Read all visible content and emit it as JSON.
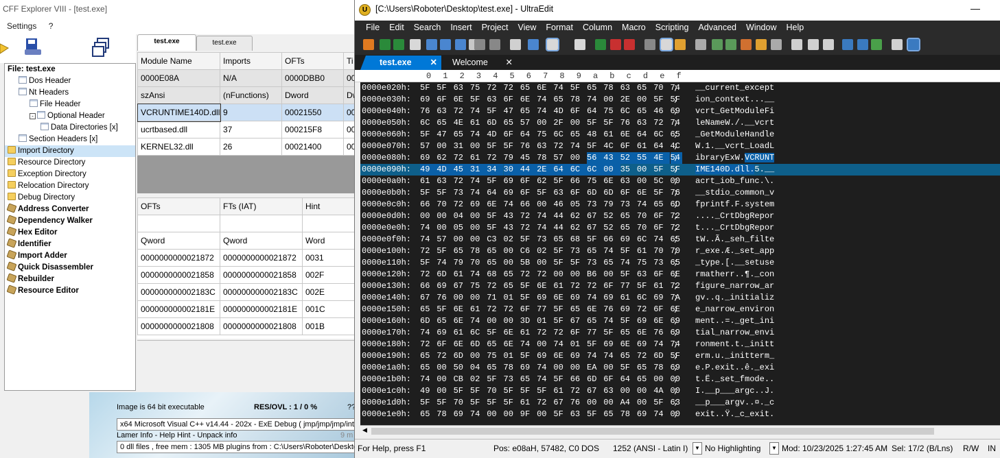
{
  "cff": {
    "title": "CFF Explorer VIII - [test.exe]",
    "menu": [
      "Settings",
      "?"
    ],
    "tabs": [
      "test.exe",
      "test.exe"
    ],
    "tree": [
      {
        "label": "File: test.exe",
        "level": 0,
        "icon": "none",
        "bold": true
      },
      {
        "label": "Dos Header",
        "level": 1,
        "icon": "doc"
      },
      {
        "label": "Nt Headers",
        "level": 1,
        "icon": "doc"
      },
      {
        "label": "File Header",
        "level": 2,
        "icon": "doc"
      },
      {
        "label": "Optional Header",
        "level": 2,
        "icon": "doc",
        "expander": "-"
      },
      {
        "label": "Data Directories [x]",
        "level": 3,
        "icon": "doc"
      },
      {
        "label": "Section Headers [x]",
        "level": 1,
        "icon": "doc"
      },
      {
        "label": "Import Directory",
        "level": 0,
        "icon": "folder",
        "selected": true
      },
      {
        "label": "Resource Directory",
        "level": 0,
        "icon": "folder"
      },
      {
        "label": "Exception Directory",
        "level": 0,
        "icon": "folder"
      },
      {
        "label": "Relocation Directory",
        "level": 0,
        "icon": "folder"
      },
      {
        "label": "Debug Directory",
        "level": 0,
        "icon": "folder"
      },
      {
        "label": "Address Converter",
        "level": 0,
        "icon": "tool",
        "bold": true
      },
      {
        "label": "Dependency Walker",
        "level": 0,
        "icon": "tool",
        "bold": true
      },
      {
        "label": "Hex Editor",
        "level": 0,
        "icon": "tool",
        "bold": true
      },
      {
        "label": "Identifier",
        "level": 0,
        "icon": "tool",
        "bold": true
      },
      {
        "label": "Import Adder",
        "level": 0,
        "icon": "tool",
        "bold": true
      },
      {
        "label": "Quick Disassembler",
        "level": 0,
        "icon": "tool",
        "bold": true
      },
      {
        "label": "Rebuilder",
        "level": 0,
        "icon": "tool",
        "bold": true
      },
      {
        "label": "Resource Editor",
        "level": 0,
        "icon": "tool",
        "bold": true
      }
    ],
    "modules_table": {
      "headers": [
        "Module Name",
        "Imports",
        "OFTs",
        "Ti"
      ],
      "subheaders": [
        "0000E08A",
        "N/A",
        "0000DBB0",
        "00"
      ],
      "types": [
        "szAnsi",
        "(nFunctions)",
        "Dword",
        "Dw"
      ],
      "rows": [
        [
          "VCRUNTIME140D.dll",
          "9",
          "00021550",
          "00"
        ],
        [
          "ucrtbased.dll",
          "37",
          "000215F8",
          "00"
        ],
        [
          "KERNEL32.dll",
          "26",
          "00021400",
          "00"
        ]
      ]
    },
    "functions_table": {
      "headers": [
        "OFTs",
        "FTs (IAT)",
        "Hint"
      ],
      "types": [
        "Qword",
        "Qword",
        "Word"
      ],
      "rows": [
        [
          "0000000000021872",
          "0000000000021872",
          "0031"
        ],
        [
          "0000000000021858",
          "0000000000021858",
          "002F"
        ],
        [
          "000000000002183C",
          "000000000002183C",
          "002E"
        ],
        [
          "000000000002181E",
          "000000000002181E",
          "001C"
        ],
        [
          "0000000000021808",
          "0000000000021808",
          "001B"
        ]
      ]
    },
    "status": {
      "image_info": "Image is 64 bit executable",
      "res_ovl": "RES/OVL : 1 / 0 %",
      "qq": "??",
      "compiler": "x64 Microsoft Visual C++ v14.44 - 202x - ExE Debug ( jmp/jmp/jmp/int",
      "lamer": "Lamer Info - Help Hint - Unpack info",
      "lamer_right": "9 m",
      "free_mem": "0 dll files , free mem : 1305 MB  plugins from : C:\\Users\\Roboter\\Deskto"
    }
  },
  "ue": {
    "title": "[C:\\Users\\Roboter\\Desktop\\test.exe] - UltraEdit",
    "logo": "U",
    "minimize": "—",
    "menu": [
      "File",
      "Edit",
      "Search",
      "Insert",
      "Project",
      "View",
      "Format",
      "Column",
      "Macro",
      "Scripting",
      "Advanced",
      "Window",
      "Help"
    ],
    "tabs": [
      {
        "label": "test.exe",
        "close": "✕"
      },
      {
        "label": "Welcome",
        "close": "✕"
      }
    ],
    "ruler": [
      "0",
      "1",
      "2",
      "3",
      "4",
      "5",
      "6",
      "7",
      "8",
      "9",
      "a",
      "b",
      "c",
      "d",
      "e",
      "f"
    ],
    "hex_rows": [
      {
        "addr": "0000e020h:",
        "bytes": "5F 5F 63 75 72 72 65 6E 74 5F 65 78 63 65 70 74",
        "ascii": "__current_except"
      },
      {
        "addr": "0000e030h:",
        "bytes": "69 6F 6E 5F 63 6F 6E 74 65 78 74 00 2E 00 5F 5F",
        "ascii": "ion_context...__"
      },
      {
        "addr": "0000e040h:",
        "bytes": "76 63 72 74 5F 47 65 74 4D 6F 64 75 6C 65 46 69",
        "ascii": "vcrt_GetModuleFi"
      },
      {
        "addr": "0000e050h:",
        "bytes": "6C 65 4E 61 6D 65 57 00 2F 00 5F 5F 76 63 72 74",
        "ascii": "leNameW./.__vcrt"
      },
      {
        "addr": "0000e060h:",
        "bytes": "5F 47 65 74 4D 6F 64 75 6C 65 48 61 6E 64 6C 65",
        "ascii": "_GetModuleHandle"
      },
      {
        "addr": "0000e070h:",
        "bytes": "57 00 31 00 5F 5F 76 63 72 74 5F 4C 6F 61 64 4C",
        "ascii": "W.1.__vcrt_LoadL"
      },
      {
        "addr": "0000e080h:",
        "bytes": "69 62 72 61 72 79 45 78 57 00 56 43 52 55 4E 54",
        "ascii": "ibraryExW.VCRUNT",
        "hl_from": 10
      },
      {
        "addr": "0000e090h:",
        "bytes": "49 4D 45 31 34 30 44 2E 64 6C 6C 00 35 00 5F 5F",
        "ascii": "IME140D.dll.5.__",
        "hl_to": 11,
        "current": true
      },
      {
        "addr": "0000e0a0h:",
        "bytes": "61 63 72 74 5F 69 6F 62 5F 66 75 6E 63 00 5C 00",
        "ascii": "acrt_iob_func.\\."
      },
      {
        "addr": "0000e0b0h:",
        "bytes": "5F 5F 73 74 64 69 6F 5F 63 6F 6D 6D 6F 6E 5F 76",
        "ascii": "__stdio_common_v"
      },
      {
        "addr": "0000e0c0h:",
        "bytes": "66 70 72 69 6E 74 66 00 46 05 73 79 73 74 65 6D",
        "ascii": "fprintf.F.system"
      },
      {
        "addr": "0000e0d0h:",
        "bytes": "00 00 04 00 5F 43 72 74 44 62 67 52 65 70 6F 72",
        "ascii": "...._CrtDbgRepor"
      },
      {
        "addr": "0000e0e0h:",
        "bytes": "74 00 05 00 5F 43 72 74 44 62 67 52 65 70 6F 72",
        "ascii": "t..._CrtDbgRepor"
      },
      {
        "addr": "0000e0f0h:",
        "bytes": "74 57 00 00 C3 02 5F 73 65 68 5F 66 69 6C 74 65",
        "ascii": "tW..Ã._seh_filte"
      },
      {
        "addr": "0000e100h:",
        "bytes": "72 5F 65 78 65 00 C6 02 5F 73 65 74 5F 61 70 70",
        "ascii": "r_exe.Æ._set_app"
      },
      {
        "addr": "0000e110h:",
        "bytes": "5F 74 79 70 65 00 5B 00 5F 5F 73 65 74 75 73 65",
        "ascii": "_type.[.__setuse"
      },
      {
        "addr": "0000e120h:",
        "bytes": "72 6D 61 74 68 65 72 72 00 00 B6 00 5F 63 6F 6E",
        "ascii": "rmatherr..¶._con"
      },
      {
        "addr": "0000e130h:",
        "bytes": "66 69 67 75 72 65 5F 6E 61 72 72 6F 77 5F 61 72",
        "ascii": "figure_narrow_ar"
      },
      {
        "addr": "0000e140h:",
        "bytes": "67 76 00 00 71 01 5F 69 6E 69 74 69 61 6C 69 7A",
        "ascii": "gv..q._initializ"
      },
      {
        "addr": "0000e150h:",
        "bytes": "65 5F 6E 61 72 72 6F 77 5F 65 6E 76 69 72 6F 6E",
        "ascii": "e_narrow_environ"
      },
      {
        "addr": "0000e160h:",
        "bytes": "6D 65 6E 74 00 00 3D 01 5F 67 65 74 5F 69 6E 69",
        "ascii": "ment..=._get_ini"
      },
      {
        "addr": "0000e170h:",
        "bytes": "74 69 61 6C 5F 6E 61 72 72 6F 77 5F 65 6E 76 69",
        "ascii": "tial_narrow_envi"
      },
      {
        "addr": "0000e180h:",
        "bytes": "72 6F 6E 6D 65 6E 74 00 74 01 5F 69 6E 69 74 74",
        "ascii": "ronment.t._initt"
      },
      {
        "addr": "0000e190h:",
        "bytes": "65 72 6D 00 75 01 5F 69 6E 69 74 74 65 72 6D 5F",
        "ascii": "erm.u._initterm_"
      },
      {
        "addr": "0000e1a0h:",
        "bytes": "65 00 50 04 65 78 69 74 00 00 EA 00 5F 65 78 69",
        "ascii": "e.P.exit..ê._exi"
      },
      {
        "addr": "0000e1b0h:",
        "bytes": "74 00 CB 02 5F 73 65 74 5F 66 6D 6F 64 65 00 00",
        "ascii": "t.Ë._set_fmode.."
      },
      {
        "addr": "0000e1c0h:",
        "bytes": "49 00 5F 5F 70 5F 5F 5F 61 72 67 63 00 00 4A 00",
        "ascii": "I.__p___argc..J."
      },
      {
        "addr": "0000e1d0h:",
        "bytes": "5F 5F 70 5F 5F 5F 61 72 67 76 00 00 A4 00 5F 63",
        "ascii": "__p___argv..¤._c"
      },
      {
        "addr": "0000e1e0h:",
        "bytes": "65 78 69 74 00 00 9F 00 5F 63 5F 65 78 69 74 00",
        "ascii": "exit..Ÿ._c_exit."
      }
    ],
    "status": {
      "help": "For Help, press F1",
      "pos": "Pos: e08aH, 57482, C0",
      "eol": "DOS",
      "encoding": "1252  (ANSI - Latin I)",
      "highlight": "No Highlighting",
      "modified": "Mod: 10/23/2025 1:27:45 AM",
      "sel": "Sel: 17/2 (B/Lns)",
      "rw": "R/W",
      "ins": "IN"
    }
  }
}
